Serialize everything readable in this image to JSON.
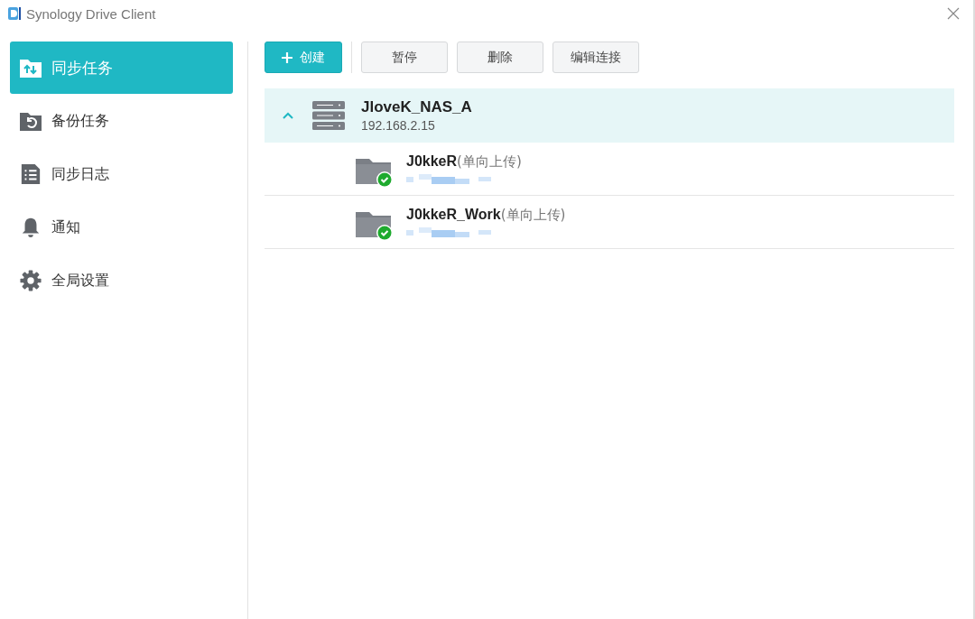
{
  "window": {
    "title": "Synology Drive Client"
  },
  "sidebar": {
    "items": [
      {
        "label": "同步任务",
        "kind": "sync",
        "selected": true
      },
      {
        "label": "备份任务",
        "kind": "backup",
        "selected": false
      },
      {
        "label": "同步日志",
        "kind": "log",
        "selected": false
      },
      {
        "label": "通知",
        "kind": "bell",
        "selected": false
      },
      {
        "label": "全局设置",
        "kind": "gear",
        "selected": false
      }
    ]
  },
  "toolbar": {
    "create": "创建",
    "buttons": [
      "暂停",
      "删除",
      "编辑连接"
    ]
  },
  "server": {
    "name": "JloveK_NAS_A",
    "address": "192.168.2.15",
    "expanded": true,
    "tasks": [
      {
        "name": "J0kkeR",
        "mode": "(单向上传)"
      },
      {
        "name": "J0kkeR_Work",
        "mode": "(单向上传)"
      }
    ]
  }
}
